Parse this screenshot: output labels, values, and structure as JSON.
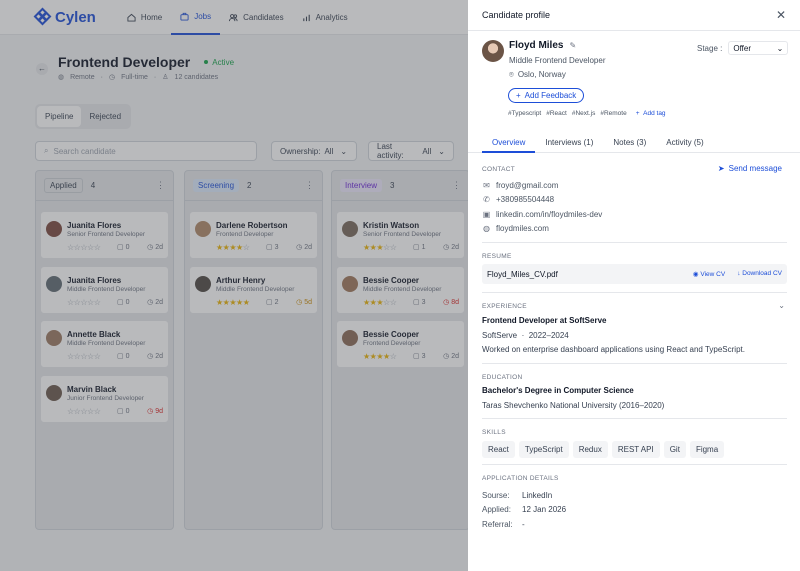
{
  "nav": {
    "brand": "Cylen",
    "items": [
      {
        "label": "Home"
      },
      {
        "label": "Jobs"
      },
      {
        "label": "Candidates"
      },
      {
        "label": "Analytics"
      }
    ]
  },
  "job": {
    "title": "Frontend Developer",
    "status": "Active",
    "location": "Remote",
    "type": "Full-time",
    "candidates": "12 candidates"
  },
  "view_tabs": [
    "Pipeline",
    "Rejected"
  ],
  "search": {
    "placeholder": "Search candidate"
  },
  "filters": {
    "ownership_label": "Ownership:",
    "ownership_value": "All",
    "activity_label": "Last activity:",
    "activity_value": "All"
  },
  "columns": [
    {
      "name": "Applied",
      "count": "4",
      "cards": [
        {
          "name": "Juanita Flores",
          "role": "Senior Frontend Developer",
          "rating": 0,
          "comments": "0",
          "days": "2d",
          "days_state": "normal"
        },
        {
          "name": "Juanita Flores",
          "role": "Middle Frontend Developer",
          "rating": 0,
          "comments": "0",
          "days": "2d",
          "days_state": "normal"
        },
        {
          "name": "Annette Black",
          "role": "Middle Frontend Developer",
          "rating": 0,
          "comments": "0",
          "days": "2d",
          "days_state": "normal"
        },
        {
          "name": "Marvin Black",
          "role": "Junior Frontend Developer",
          "rating": 0,
          "comments": "0",
          "days": "9d",
          "days_state": "alert"
        }
      ]
    },
    {
      "name": "Screening",
      "count": "2",
      "cards": [
        {
          "name": "Darlene Robertson",
          "role": "Frontend Developer",
          "rating": 4,
          "comments": "3",
          "days": "2d",
          "days_state": "normal"
        },
        {
          "name": "Arthur Henry",
          "role": "Middle Frontend Developer",
          "rating": 5,
          "comments": "2",
          "days": "5d",
          "days_state": "warn"
        }
      ]
    },
    {
      "name": "Interview",
      "count": "3",
      "cards": [
        {
          "name": "Kristin Watson",
          "role": "Senior Frontend Developer",
          "rating": 3,
          "comments": "1",
          "days": "2d",
          "days_state": "normal"
        },
        {
          "name": "Bessie Cooper",
          "role": "Middle Frontend Developer",
          "rating": 3,
          "comments": "3",
          "days": "8d",
          "days_state": "alert"
        },
        {
          "name": "Bessie Cooper",
          "role": "Frontend Developer",
          "rating": 4,
          "comments": "3",
          "days": "2d",
          "days_state": "normal"
        }
      ]
    }
  ],
  "drawer": {
    "title": "Candidate profile",
    "name": "Floyd Miles",
    "role": "Middle Frontend Developer",
    "location": "Oslo, Norway",
    "stage_label": "Stage :",
    "stage_value": "Offer",
    "feedback_button": "Add Feedback",
    "tags": [
      "#Typescript",
      "#React",
      "#Next.js",
      "#Remote"
    ],
    "add_tag": "Add tag",
    "tabs": [
      {
        "label": "Overview"
      },
      {
        "label": "Interviews",
        "count": "(1)"
      },
      {
        "label": "Notes",
        "count": "(3)"
      },
      {
        "label": "Activity",
        "count": "(5)"
      }
    ],
    "contact": {
      "label": "CONTACT",
      "send": "Send message",
      "email": "froyd@gmail.com",
      "phone": "+380985504448",
      "linkedin": "linkedin.com/in/floydmiles-dev",
      "website": "floydmiles.com"
    },
    "resume": {
      "label": "RESUME",
      "file": "Floyd_Miles_CV.pdf",
      "view": "View CV",
      "download": "Download CV"
    },
    "experience": {
      "label": "EXPERIENCE",
      "title": "Frontend Developer at SoftServe",
      "company": "SoftServe",
      "period": "2022–2024",
      "description": "Worked on enterprise dashboard applications using React and TypeScript."
    },
    "education": {
      "label": "EDUCATION",
      "degree": "Bachelor's Degree in Computer Science",
      "school": "Taras Shevchenko National University (2016–2020)"
    },
    "skills": {
      "label": "SKILLS",
      "items": [
        "React",
        "TypeScript",
        "Redux",
        "REST API",
        "Git",
        "Figma"
      ]
    },
    "application": {
      "label": "APPLICATION DETAILS",
      "source_label": "Sourse:",
      "source": "LinkedIn",
      "applied_label": "Applied:",
      "applied": "12 Jan 2026",
      "referral_label": "Referral:",
      "referral": "-"
    }
  }
}
